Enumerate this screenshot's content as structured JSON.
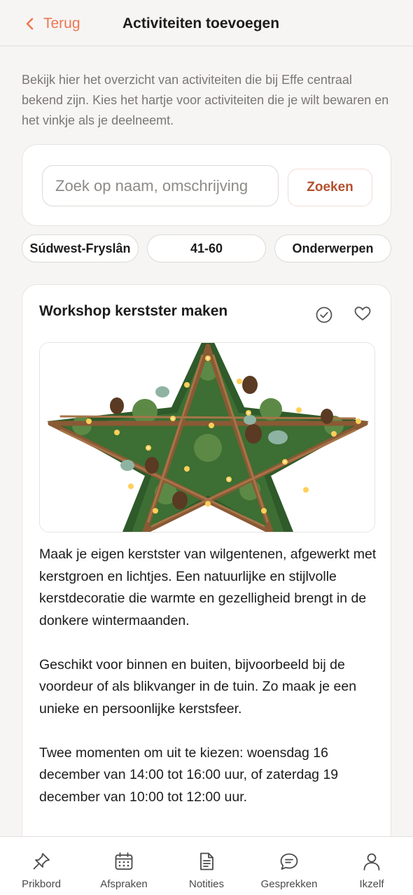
{
  "header": {
    "back_label": "Terug",
    "title": "Activiteiten toevoegen"
  },
  "intro_text": "Bekijk hier het overzicht van activiteiten die bij Effe centraal bekend zijn. Kies het hartje voor activiteiten die je wilt bewaren en het vinkje als je deelneemt.",
  "search": {
    "placeholder": "Zoek op naam, omschrijving",
    "value": "",
    "button_label": "Zoeken"
  },
  "filters": {
    "region": "Súdwest-Fryslân",
    "age": "41-60",
    "topics": "Onderwerpen"
  },
  "activity": {
    "title": "Workshop kerstster maken",
    "image_alt": "Kerstster van wilgentenen met kerstgroen en lichtjes",
    "paragraphs": [
      "Maak je eigen kerstster van wilgentenen, afgewerkt met kerstgroen en lichtjes. Een natuurlijke en stijlvolle kerstdecoratie die warmte en gezelligheid brengt in de donkere wintermaanden.",
      "Geschikt voor binnen en buiten, bijvoorbeeld bij de voordeur of als blikvanger in de tuin. Zo maak je een unieke en persoonlijke kerstsfeer.",
      "Twee momenten om uit te kiezen: woensdag 16 december van 14:00 tot 16:00 uur, of zaterdag 19 december van 10:00 tot 12:00 uur."
    ],
    "participate_icon": "check-circle-icon",
    "favorite_icon": "heart-icon"
  },
  "tabbar": {
    "items": [
      {
        "label": "Prikbord",
        "icon": "pin-icon"
      },
      {
        "label": "Afspraken",
        "icon": "calendar-icon"
      },
      {
        "label": "Notities",
        "icon": "document-icon"
      },
      {
        "label": "Gesprekken",
        "icon": "chat-bubble-icon"
      },
      {
        "label": "Ikzelf",
        "icon": "person-icon"
      }
    ]
  },
  "colors": {
    "accent": "#ee7650",
    "accent_dark": "#b5502f",
    "background": "#f6f5f4",
    "card": "#ffffff",
    "text": "#1c1c1c",
    "muted_text": "#7a7774"
  }
}
